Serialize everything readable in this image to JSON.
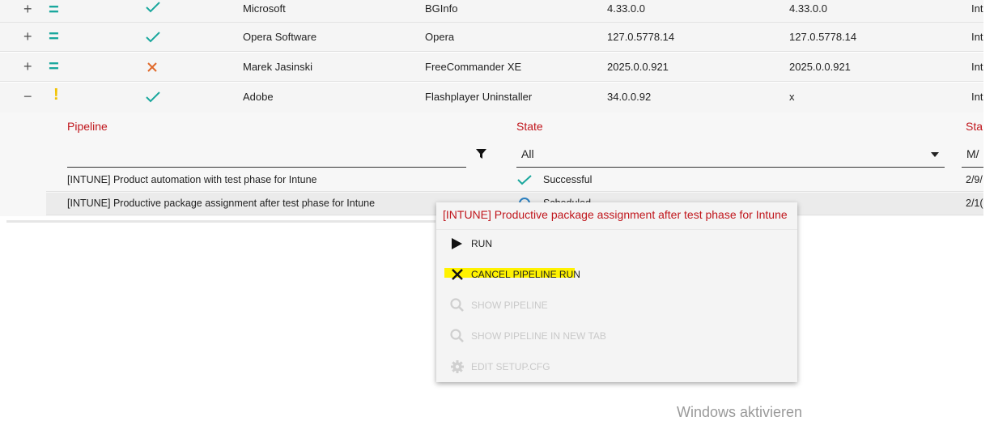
{
  "rows": [
    {
      "toggle": "+",
      "level": "=",
      "status": "ok",
      "vendor": "Microsoft",
      "product": "BGInfo",
      "version_a": "4.33.0.0",
      "version_b": "4.33.0.0",
      "type": "Int"
    },
    {
      "toggle": "+",
      "level": "=",
      "status": "ok",
      "vendor": "Opera Software",
      "product": "Opera",
      "version_a": "127.0.5778.14",
      "version_b": "127.0.5778.14",
      "type": "Int"
    },
    {
      "toggle": "+",
      "level": "=",
      "status": "fail",
      "vendor": "Marek Jasinski",
      "product": "FreeCommander XE",
      "version_a": "2025.0.0.921",
      "version_b": "2025.0.0.921",
      "type": "Int"
    },
    {
      "toggle": "−",
      "level": "!",
      "status": "ok",
      "vendor": "Adobe",
      "product": "Flashplayer Uninstaller",
      "version_a": "34.0.0.92",
      "version_b": "x",
      "type": "Int"
    }
  ],
  "detail": {
    "col_pipeline": "Pipeline",
    "col_state": "State",
    "col_start": "Sta",
    "state_filter": "All",
    "start_filter": "M/",
    "pipelines": [
      {
        "name": "[INTUNE] Product automation with test phase for Intune",
        "state": "Successful",
        "date": "2/9/"
      },
      {
        "name": "[INTUNE] Productive package assignment after test phase for Intune",
        "state": "Scheduled",
        "date": "2/1("
      }
    ]
  },
  "context_menu": {
    "title": "[INTUNE] Productive package assignment after test phase for Intune",
    "run": "RUN",
    "cancel": "CANCEL PIPELINE RUN",
    "show": "SHOW PIPELINE",
    "show_new_tab": "SHOW PIPELINE IN NEW TAB",
    "edit_setup": "EDIT SETUP.CFG"
  },
  "watermark": "Windows aktivieren",
  "colors": {
    "accent_red": "#c0161c",
    "teal": "#1aa79d",
    "warn": "#f2c200",
    "error": "#e06a2a",
    "highlight": "#fff200"
  }
}
